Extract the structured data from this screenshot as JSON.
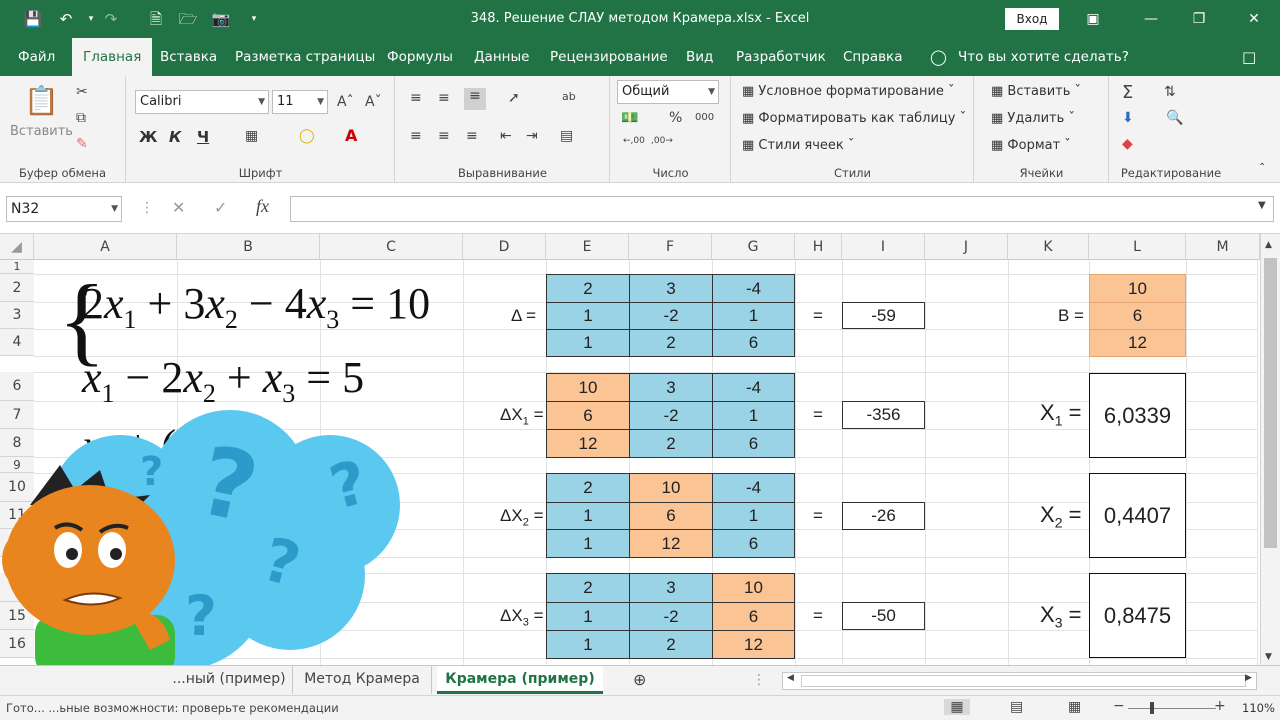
{
  "titlebar": {
    "title": "348. Решение СЛАУ методом Крамера.xlsx  -  Excel",
    "signin": "Вход"
  },
  "ribbon_tabs": [
    "Файл",
    "Главная",
    "Вставка",
    "Разметка страницы",
    "Формулы",
    "Данные",
    "Рецензирование",
    "Вид",
    "Разработчик",
    "Справка"
  ],
  "tell_me": "Что вы хотите сделать?",
  "ribbon": {
    "clipboard": {
      "paste": "Вставить",
      "label": "Буфер обмена"
    },
    "font": {
      "name": "Calibri",
      "size": "11",
      "bold": "Ж",
      "italic": "К",
      "underline": "Ч",
      "label": "Шрифт"
    },
    "alignment": {
      "label": "Выравнивание"
    },
    "number": {
      "format": "Общий",
      "label": "Число"
    },
    "styles": {
      "cond": "Условное форматирование",
      "table": "Форматировать как таблицу",
      "cell": "Стили ячеек",
      "label": "Стили"
    },
    "cells": {
      "insert": "Вставить",
      "delete": "Удалить",
      "format": "Формат",
      "label": "Ячейки"
    },
    "editing": {
      "label": "Редактирование"
    }
  },
  "namebox": "N32",
  "formula": "",
  "columns": [
    "A",
    "B",
    "C",
    "D",
    "E",
    "F",
    "G",
    "H",
    "I",
    "J",
    "K",
    "L",
    "M"
  ],
  "rows": [
    "1",
    "2",
    "3",
    "4",
    "6",
    "7",
    "8",
    "9",
    "10",
    "11",
    "1",
    "1",
    "15",
    "16"
  ],
  "system": {
    "line1": "2x₁ + 3x₂ − 4x₃ = 10",
    "line2": "x₁ − 2x₂ + x₃ = 5",
    "line3": "x₁ + ( ... = 2"
  },
  "blocks": [
    {
      "label": "Δ =",
      "cells": [
        [
          "2",
          "3",
          "-4"
        ],
        [
          "1",
          "-2",
          "1"
        ],
        [
          "1",
          "2",
          "6"
        ]
      ],
      "result": "-59"
    },
    {
      "label": "ΔX",
      "sub": "1",
      "cells": [
        [
          "10",
          "3",
          "-4"
        ],
        [
          "6",
          "-2",
          "1"
        ],
        [
          "12",
          "2",
          "6"
        ]
      ],
      "result": "-356"
    },
    {
      "label": "ΔX",
      "sub": "2",
      "cells": [
        [
          "2",
          "10",
          "-4"
        ],
        [
          "1",
          "6",
          "1"
        ],
        [
          "1",
          "12",
          "6"
        ]
      ],
      "result": "-26"
    },
    {
      "label": "ΔX",
      "sub": "3",
      "cells": [
        [
          "2",
          "3",
          "10"
        ],
        [
          "1",
          "-2",
          "6"
        ],
        [
          "1",
          "2",
          "12"
        ]
      ],
      "result": "-50"
    }
  ],
  "equals": "=",
  "b_label": "B =",
  "b_values": [
    "10",
    "6",
    "12"
  ],
  "answers": [
    {
      "label": "X",
      "sub": "1",
      "value": "6,0339"
    },
    {
      "label": "X",
      "sub": "2",
      "value": "0,4407"
    },
    {
      "label": "X",
      "sub": "3",
      "value": "0,8475"
    }
  ],
  "sheets": [
    "...ный (пример)",
    "Метод Крамера",
    "Крамера (пример)"
  ],
  "status": {
    "text": "Гото...   ...ьные возможности: проверьте рекомендации",
    "zoom": "110%"
  },
  "colors": {
    "excel_green": "#217346",
    "cell_blue": "#9bd3e6",
    "cell_orange": "#fbc495",
    "bubble": "#5bc8f0"
  }
}
